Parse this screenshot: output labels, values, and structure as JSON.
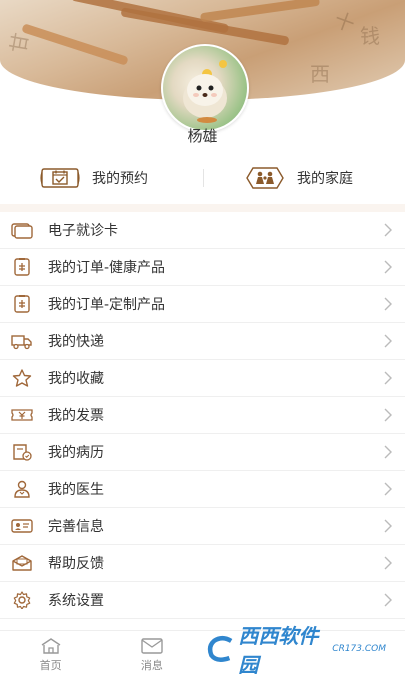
{
  "profile": {
    "name": "杨雄"
  },
  "quick_links": [
    {
      "label": "我的预约",
      "icon": "calendar-scroll-icon"
    },
    {
      "label": "我的家庭",
      "icon": "family-icon"
    }
  ],
  "menu": [
    {
      "label": "电子就诊卡",
      "icon": "card-icon"
    },
    {
      "label": "我的订单-健康产品",
      "icon": "order-icon"
    },
    {
      "label": "我的订单-定制产品",
      "icon": "order-icon"
    },
    {
      "label": "我的快递",
      "icon": "delivery-truck-icon"
    },
    {
      "label": "我的收藏",
      "icon": "star-icon"
    },
    {
      "label": "我的发票",
      "icon": "invoice-icon"
    },
    {
      "label": "我的病历",
      "icon": "medical-record-icon"
    },
    {
      "label": "我的医生",
      "icon": "doctor-icon"
    },
    {
      "label": "完善信息",
      "icon": "id-card-icon"
    },
    {
      "label": "帮助反馈",
      "icon": "feedback-icon"
    },
    {
      "label": "系统设置",
      "icon": "gear-icon"
    }
  ],
  "tabbar": [
    {
      "label": "首页",
      "icon": "home-icon"
    },
    {
      "label": "消息",
      "icon": "mail-icon"
    }
  ],
  "watermark": {
    "logo": "西西软件园",
    "sub": "CR173.COM"
  },
  "colors": {
    "accent": "#8b5a2b",
    "icon": "#a0683a",
    "separator": "#faf4ef"
  }
}
